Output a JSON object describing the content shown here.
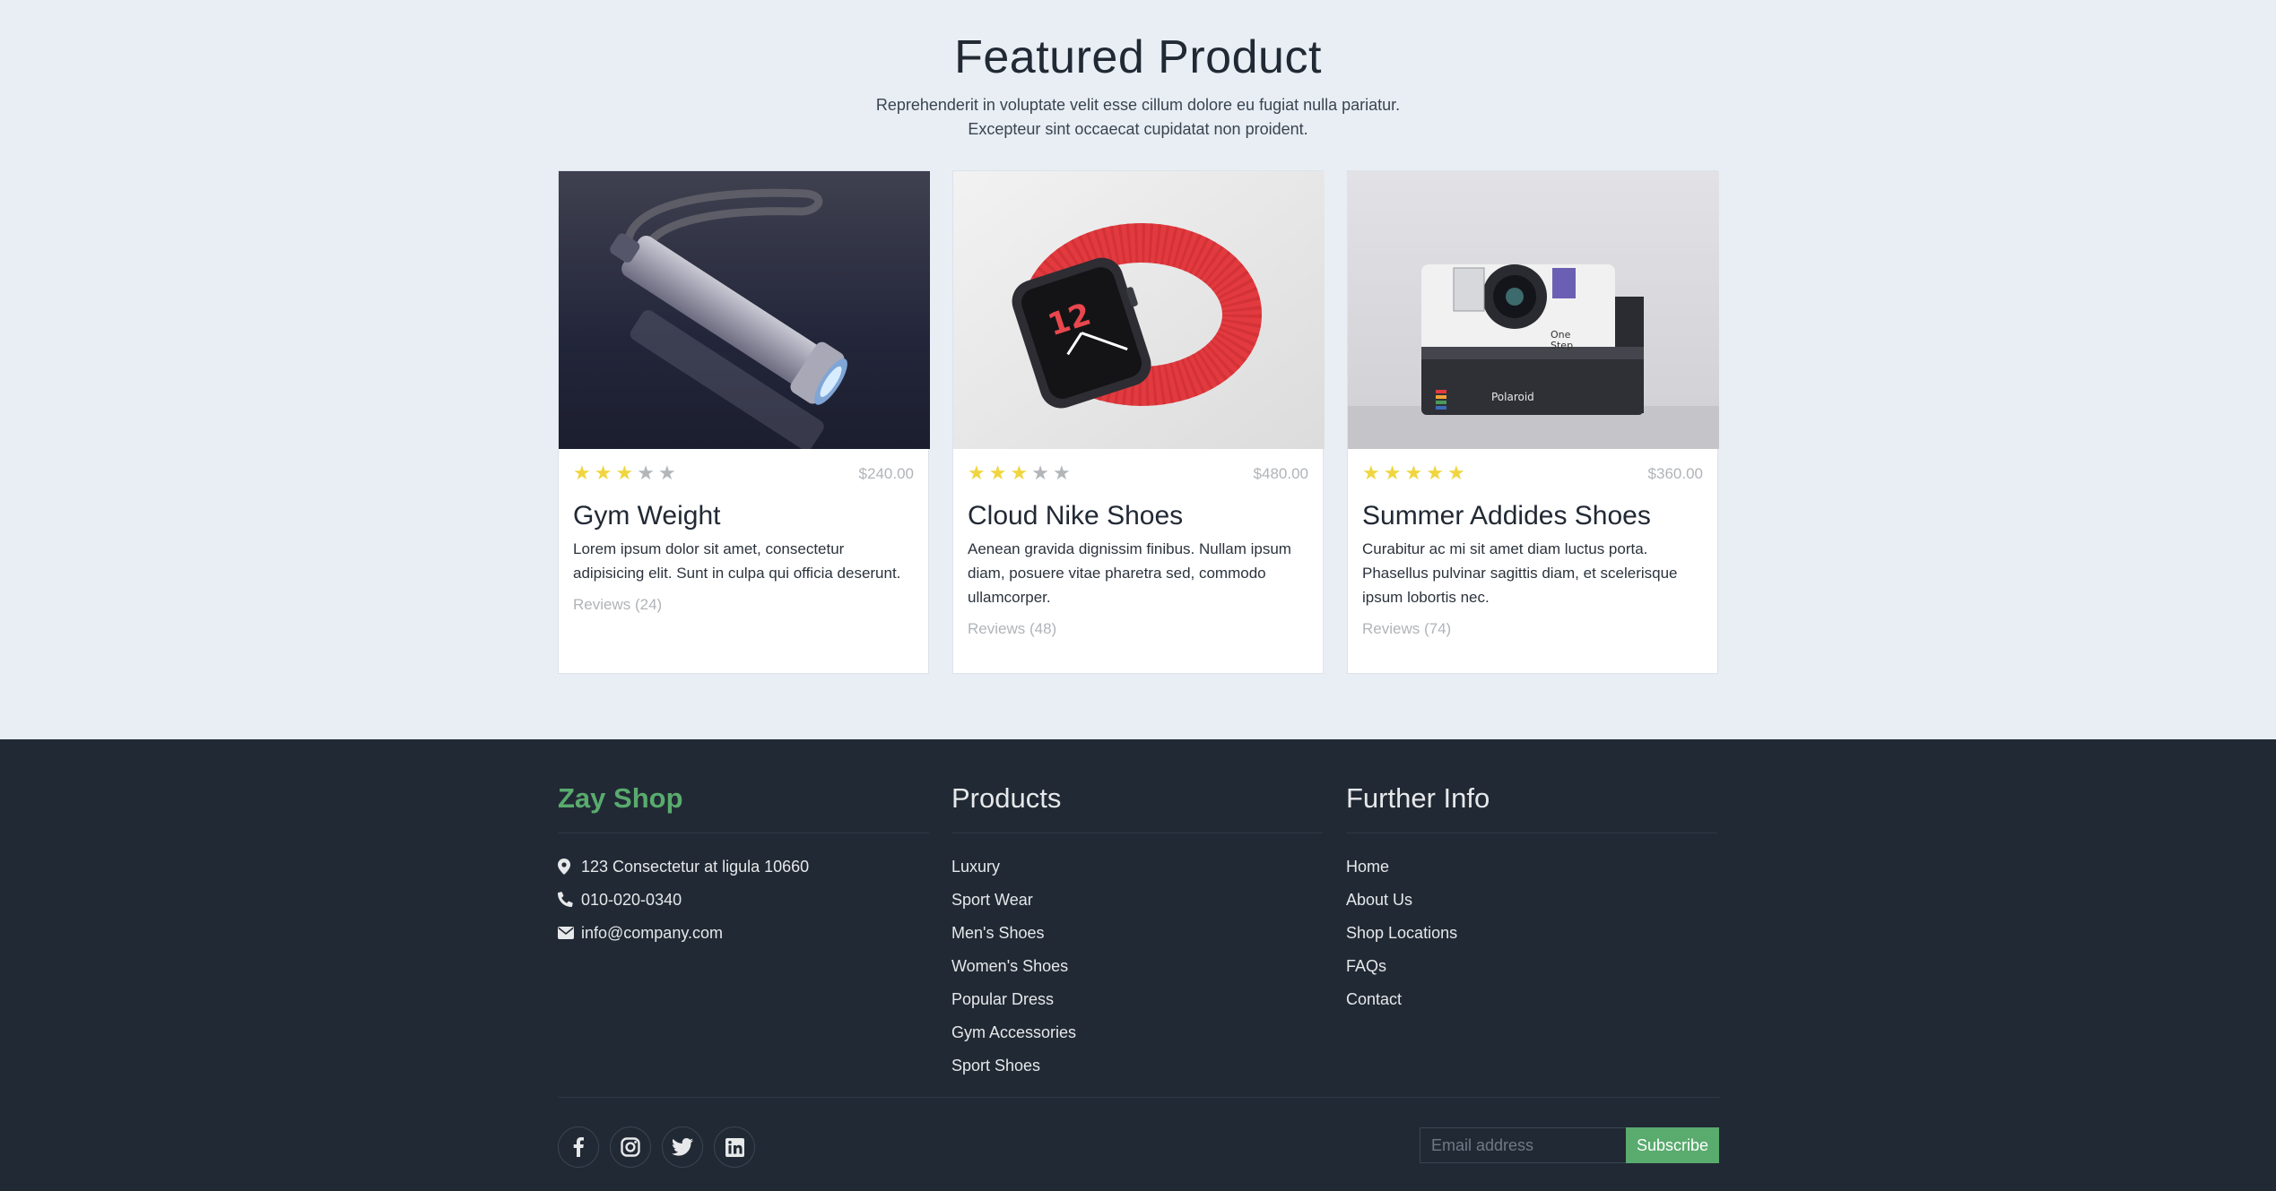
{
  "featured": {
    "title": "Featured Product",
    "desc_line1": "Reprehenderit in voluptate velit esse cillum dolore eu fugiat nulla pariatur.",
    "desc_line2": "Excepteur sint occaecat cupidatat non proident."
  },
  "products": [
    {
      "name": "Gym Weight",
      "price": "$240.00",
      "rating": 3,
      "rating_max": 5,
      "description": "Lorem ipsum dolor sit amet, consectetur adipisicing elit. Sunt in culpa qui officia deserunt.",
      "reviews": "Reviews (24)",
      "image": "flashlight"
    },
    {
      "name": "Cloud Nike Shoes",
      "price": "$480.00",
      "rating": 3,
      "rating_max": 5,
      "description": "Aenean gravida dignissim finibus. Nullam ipsum diam, posuere vitae pharetra sed, commodo ullamcorper.",
      "reviews": "Reviews (48)",
      "image": "smartwatch"
    },
    {
      "name": "Summer Addides Shoes",
      "price": "$360.00",
      "rating": 5,
      "rating_max": 5,
      "description": "Curabitur ac mi sit amet diam luctus porta. Phasellus pulvinar sagittis diam, et scelerisque ipsum lobortis nec.",
      "reviews": "Reviews (74)",
      "image": "instant-camera"
    }
  ],
  "footer": {
    "brand": "Zay Shop",
    "address": "123 Consectetur at ligula 10660",
    "phone": "010-020-0340",
    "email": "info@company.com",
    "products_title": "Products",
    "products_links": [
      "Luxury",
      "Sport Wear",
      "Men's Shoes",
      "Women's Shoes",
      "Popular Dress",
      "Gym Accessories",
      "Sport Shoes"
    ],
    "info_title": "Further Info",
    "info_links": [
      "Home",
      "About Us",
      "Shop Locations",
      "FAQs",
      "Contact"
    ],
    "email_placeholder": "Email address",
    "subscribe_label": "Subscribe",
    "social_icons": [
      "facebook-icon",
      "instagram-icon",
      "twitter-icon",
      "linkedin-icon"
    ]
  },
  "colors": {
    "accent": "#59ab6e",
    "star_on": "#f0d53e",
    "star_off": "#b3b6b9",
    "footer_bg": "#212934",
    "page_bg": "#e9eef5"
  }
}
